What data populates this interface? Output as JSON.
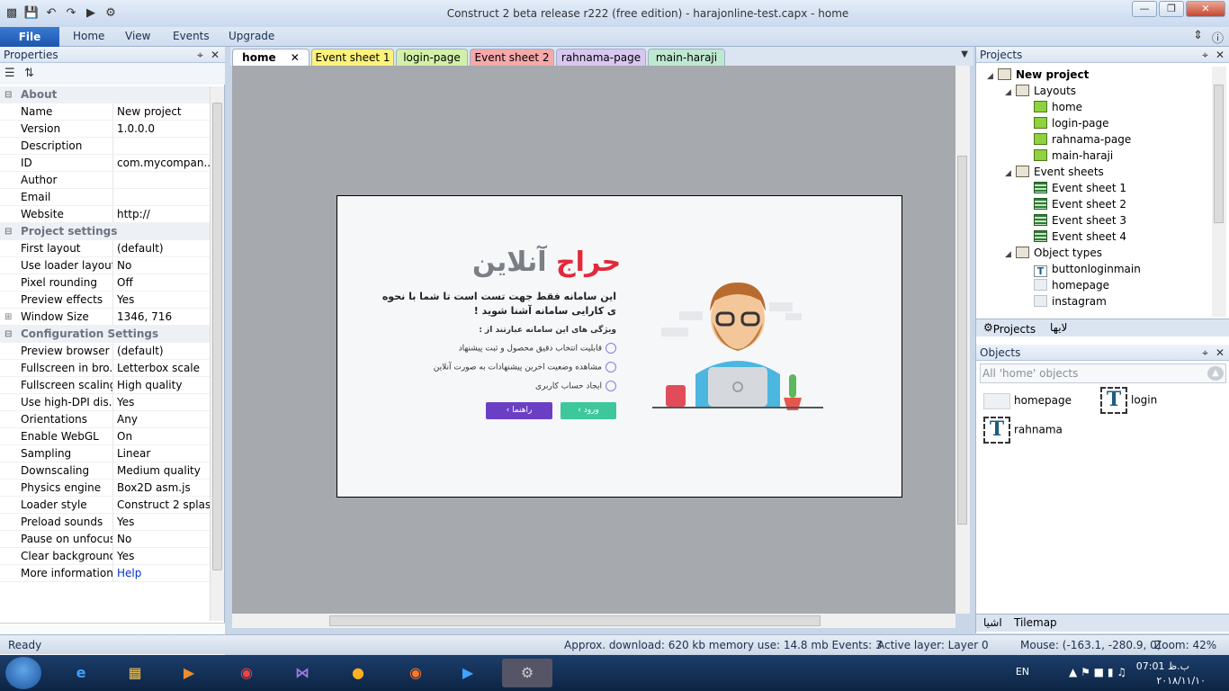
{
  "window": {
    "title": "Construct 2 beta release r222  (free edition) - harajonline-test.capx - home",
    "controls": [
      "—",
      "❐",
      "✕"
    ]
  },
  "ribbon": {
    "file": "File",
    "tabs": [
      "Home",
      "View",
      "Events",
      "Upgrade"
    ]
  },
  "properties": {
    "title": "Properties",
    "rows": [
      {
        "type": "cat",
        "label": "About"
      },
      {
        "k": "Name",
        "v": "New project"
      },
      {
        "k": "Version",
        "v": "1.0.0.0"
      },
      {
        "k": "Description",
        "v": ""
      },
      {
        "k": "ID",
        "v": "com.mycompan..."
      },
      {
        "k": "Author",
        "v": ""
      },
      {
        "k": "Email",
        "v": ""
      },
      {
        "k": "Website",
        "v": "http://"
      },
      {
        "type": "cat",
        "label": "Project settings"
      },
      {
        "k": "First layout",
        "v": "(default)"
      },
      {
        "k": "Use loader layout",
        "v": "No"
      },
      {
        "k": "Pixel rounding",
        "v": "Off"
      },
      {
        "k": "Preview effects",
        "v": "Yes"
      },
      {
        "k": "Window Size",
        "v": "1346, 716",
        "expand": true
      },
      {
        "type": "cat",
        "label": "Configuration Settings"
      },
      {
        "k": "Preview browser",
        "v": "(default)"
      },
      {
        "k": "Fullscreen in bro...",
        "v": "Letterbox scale"
      },
      {
        "k": "Fullscreen scaling",
        "v": "High quality"
      },
      {
        "k": "Use high-DPI dis...",
        "v": "Yes"
      },
      {
        "k": "Orientations",
        "v": "Any"
      },
      {
        "k": "Enable WebGL",
        "v": "On"
      },
      {
        "k": "Sampling",
        "v": "Linear"
      },
      {
        "k": "Downscaling",
        "v": "Medium quality"
      },
      {
        "k": "Physics engine",
        "v": "Box2D asm.js"
      },
      {
        "k": "Loader style",
        "v": "Construct 2 splash"
      },
      {
        "k": "Preload sounds",
        "v": "Yes"
      },
      {
        "k": "Pause on unfocus",
        "v": "No"
      },
      {
        "k": "Clear background",
        "v": "Yes"
      },
      {
        "k": "More information",
        "v": "Help"
      }
    ]
  },
  "doc_tabs": [
    {
      "label": "home",
      "color": "#ffffff",
      "active": true
    },
    {
      "label": "Event sheet 1",
      "color": "#fff27a"
    },
    {
      "label": "login-page",
      "color": "#d2f0a8"
    },
    {
      "label": "Event sheet 2",
      "color": "#f5a9a9"
    },
    {
      "label": "rahnama-page",
      "color": "#d8c7f0"
    },
    {
      "label": "main-haraji",
      "color": "#bfe8d0"
    }
  ],
  "layout_preview": {
    "brand_red": "حراج",
    "brand_gray": "آنلاین",
    "lead": "این سامانه فقط جهت تست است تا شما با نحوه ی کارایی سامانه آشنا شوید !",
    "features_title": "ویژگی های این سامانه عبارتند از :",
    "features": [
      "قابلیت انتخاب دقیق محصول و ثبت پیشنهاد",
      "مشاهده وضعیت اخرین پیشنهادات به صورت آنلاین",
      "ایجاد حساب کاربری"
    ],
    "btn_guide": "راهنما",
    "btn_login": "ورود",
    "colors": {
      "red": "#e3283a",
      "purple": "#6b3fc4",
      "green": "#3ec79a"
    }
  },
  "projects": {
    "title": "Projects",
    "root": "New project",
    "layouts_label": "Layouts",
    "layouts": [
      "home",
      "login-page",
      "rahnama-page",
      "main-haraji"
    ],
    "eventsheets_label": "Event sheets",
    "eventsheets": [
      "Event sheet 1",
      "Event sheet 2",
      "Event sheet 3",
      "Event sheet 4"
    ],
    "objecttypes_label": "Object types",
    "objecttypes": [
      {
        "name": "buttonloginmain",
        "icon": "text-icon"
      },
      {
        "name": "homepage",
        "icon": "image-icon"
      },
      {
        "name": "instagram",
        "icon": "image-icon"
      }
    ],
    "tabs": [
      "Projects",
      "لایها"
    ]
  },
  "objects": {
    "title": "Objects",
    "filter": "All 'home' objects",
    "items": [
      {
        "name": "homepage",
        "icon": "image-icon"
      },
      {
        "name": "login",
        "icon": "text-icon"
      },
      {
        "name": "rahnama",
        "icon": "text-icon"
      }
    ],
    "tabs": [
      "اشیا",
      "Tilemap"
    ]
  },
  "status": {
    "ready": "Ready",
    "download": "Approx. download: 620 kb  memory use: 14.8 mb  Events: 3",
    "layer": "Active layer: Layer 0",
    "mouse": "Mouse: (-163.1, -280.9, 0)",
    "zoom": "Zoom: 42%"
  },
  "taskbar": {
    "lang": "EN",
    "time": "07:01 ب.ظ",
    "date": "۲۰۱۸/۱۱/۱۰"
  }
}
